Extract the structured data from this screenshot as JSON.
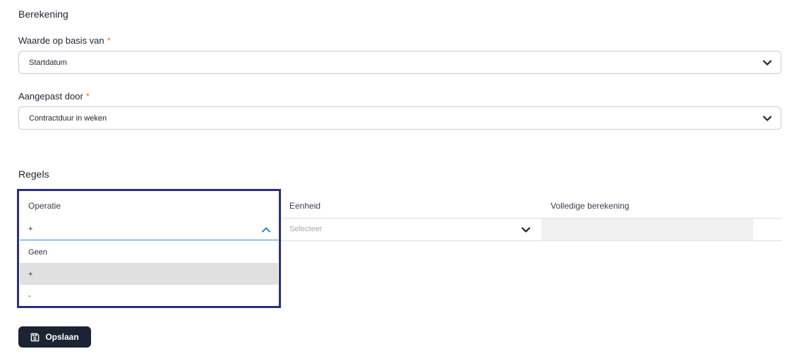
{
  "calculation": {
    "title": "Berekening",
    "based_on": {
      "label": "Waarde op basis van",
      "required_mark": "*",
      "value": "Startdatum"
    },
    "adjusted_by": {
      "label": "Aangepast door",
      "required_mark": "*",
      "value": "Contractduur in weken"
    }
  },
  "rules": {
    "title": "Regels",
    "columns": [
      "Operatie",
      "Eenheid",
      "Volledige berekening"
    ],
    "row": {
      "operation": "+",
      "unit_placeholder": "Selecteer",
      "full_calculation": ""
    },
    "operation_options": [
      {
        "label": "Geen",
        "selected": false
      },
      {
        "label": "+",
        "selected": true
      },
      {
        "label": "-",
        "selected": false
      }
    ]
  },
  "actions": {
    "save_label": "Opslaan"
  },
  "colors": {
    "accent": "#2d8fd6",
    "required": "#e8772e",
    "button": "#1c2333",
    "highlight": "#2b2f7f"
  },
  "icons": {
    "select_chevron": "chevron-down-icon",
    "open_chevron": "chevron-up-icon",
    "save": "floppy-disk-icon"
  }
}
